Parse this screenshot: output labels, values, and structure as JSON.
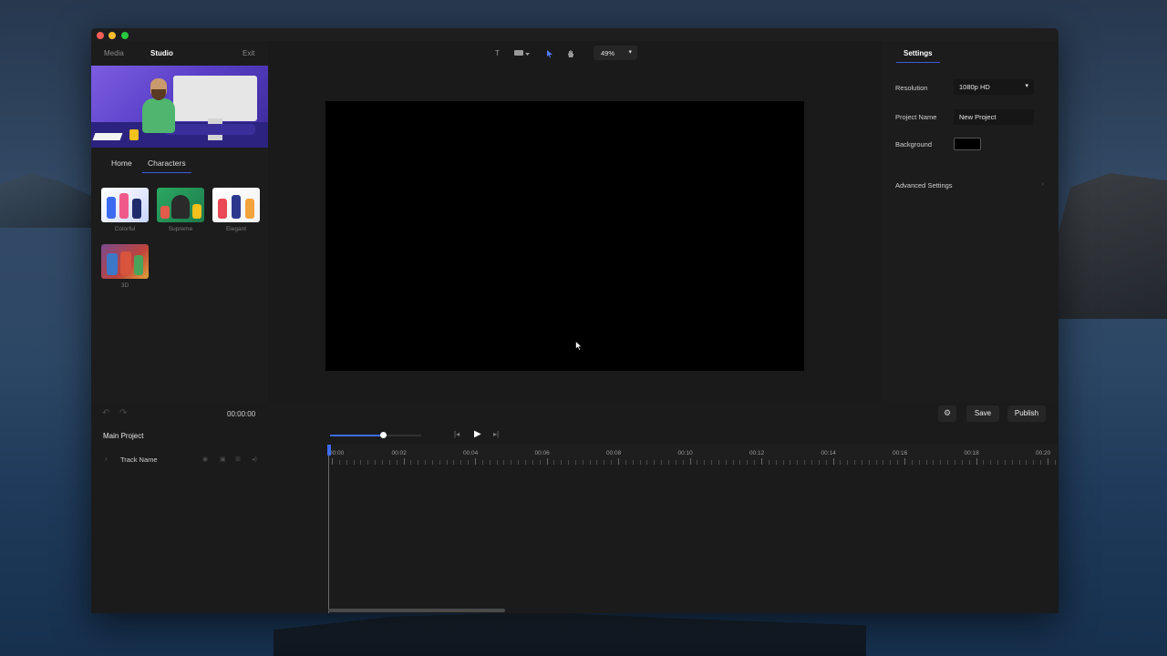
{
  "app": {
    "top_tabs": [
      {
        "label": "Media"
      },
      {
        "label": "Studio"
      },
      {
        "label": "Exit"
      }
    ]
  },
  "library": {
    "tabs": [
      {
        "label": "Home"
      },
      {
        "label": "Characters"
      }
    ],
    "items": [
      {
        "label": "Colorful"
      },
      {
        "label": "Supreme"
      },
      {
        "label": "Elegant"
      },
      {
        "label": "3D"
      }
    ]
  },
  "toolbar": {
    "tools": [
      "text-tool-icon",
      "shape-tool-icon",
      "select-tool-icon",
      "hand-tool-icon"
    ],
    "text_tool_glyph": "T",
    "zoom": "49%"
  },
  "settings": {
    "tab": "Settings",
    "resolution_label": "Resolution",
    "resolution_value": "1080p HD",
    "project_name_label": "Project Name",
    "project_name_value": "New Project",
    "background_label": "Background",
    "background_color": "#000000",
    "advanced_label": "Advanced Settings"
  },
  "actions": {
    "save": "Save",
    "publish": "Publish"
  },
  "playback": {
    "timecode": "00:00:00"
  },
  "timeline": {
    "project_tab": "Main Project",
    "zoom_level": 0.58,
    "track_name": "Track Name",
    "ticks": [
      "00:00",
      "00:02",
      "00:04",
      "00:06",
      "00:08",
      "00:10",
      "00:12",
      "00:14",
      "00:16",
      "00:18",
      "00:20"
    ]
  },
  "colors": {
    "accent": "#3d6cf0",
    "panel": "#1c1c1c",
    "canvas": "#000000"
  }
}
